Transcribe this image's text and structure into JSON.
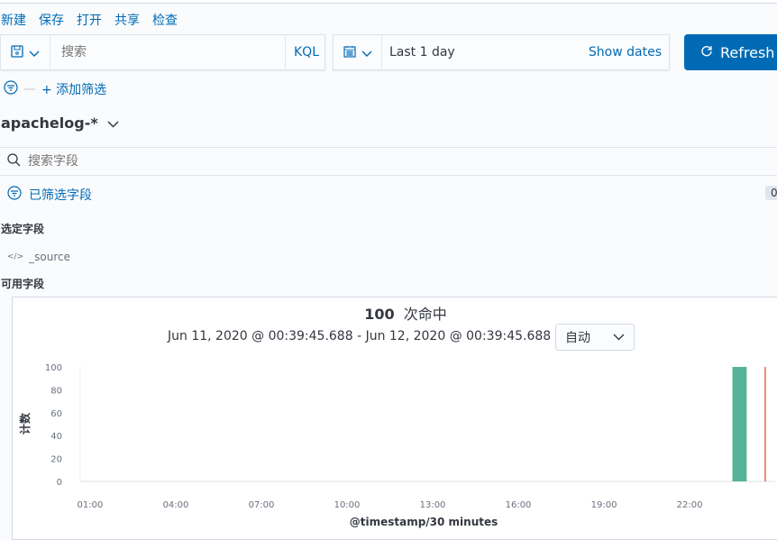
{
  "menu": [
    "新建",
    "保存",
    "打开",
    "共享",
    "检查"
  ],
  "query": {
    "placeholder": "搜索",
    "language": "KQL"
  },
  "time": {
    "range": "Last 1 day",
    "show_dates": "Show dates"
  },
  "refresh": "Refresh",
  "filter": {
    "add": "+ 添加筛选"
  },
  "index_pattern": "apachelog-*",
  "field_search": {
    "placeholder": "搜索字段"
  },
  "filtered_fields": {
    "label": "已筛选字段",
    "count": "0"
  },
  "selected_fields": {
    "title": "选定字段",
    "items": [
      "_source"
    ]
  },
  "available_fields": {
    "title": "可用字段"
  },
  "hits": {
    "count": "100",
    "label": "次命中"
  },
  "date_range": "Jun 11, 2020 @ 00:39:45.688 - Jun 12, 2020 @ 00:39:45.688 —",
  "interval": "自动",
  "colors": {
    "accent": "#006bb4",
    "bar": "#54b399",
    "now_line": "#e7664c"
  },
  "chart_data": {
    "type": "bar",
    "xlabel": "@timestamp/30 minutes",
    "ylabel": "计数",
    "xlim": [
      "2020-06-11 00:39:45",
      "2020-06-12 00:39:45"
    ],
    "ylim": [
      0,
      100
    ],
    "x_ticks": [
      "01:00",
      "04:00",
      "07:00",
      "10:00",
      "13:00",
      "16:00",
      "19:00",
      "22:00"
    ],
    "y_ticks": [
      0,
      20,
      40,
      60,
      80,
      100
    ],
    "bars": [
      {
        "x": "23:30",
        "value": 100
      }
    ],
    "now_marker": "00:39:45"
  }
}
